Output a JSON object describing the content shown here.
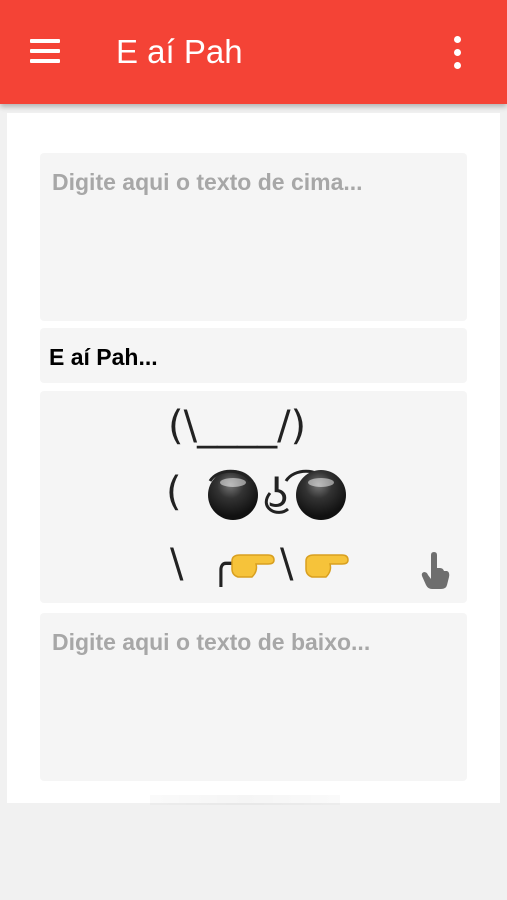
{
  "appbar": {
    "title": "E aí Pah",
    "menu_icon": "hamburger-menu-icon",
    "overflow_icon": "more-vert-icon",
    "color": "#f44336"
  },
  "editor": {
    "top_input": {
      "placeholder": "Digite aqui o texto de cima...",
      "value": ""
    },
    "top_caption": "E aí Pah...",
    "meme": {
      "line1": "(\\____/)",
      "line2_left": "(",
      "line2_middle": "ʖ",
      "line3_left": "\\  ╭",
      "line3_mid": "\\",
      "hand_icon": "backhand-index-pointing-right",
      "glasses_icon": "sunglasses-lens",
      "touch_icon": "touch-hand-icon"
    },
    "bottom_input": {
      "placeholder": "Digite aqui o texto de baixo...",
      "value": ""
    }
  }
}
